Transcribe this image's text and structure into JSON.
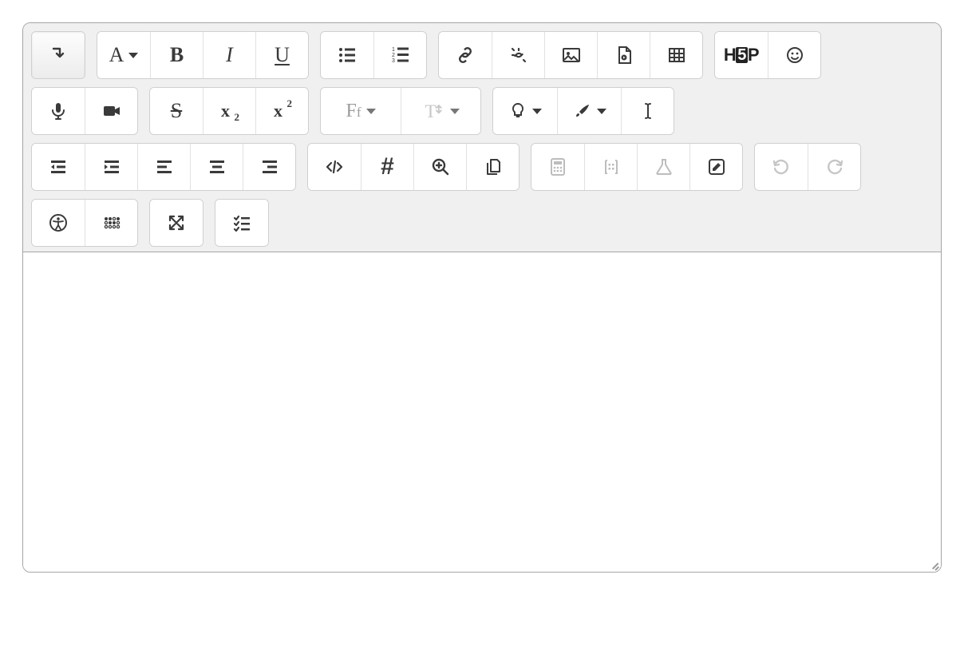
{
  "toolbar": {
    "collapse": {
      "name": "toggle-toolbar-button",
      "active": true
    },
    "paragraph_style": {
      "name": "paragraph-style-dropdown",
      "label": "A"
    },
    "bold": {
      "label": "B"
    },
    "italic": {
      "label": "I"
    },
    "underline": {
      "label": "U"
    },
    "strike": {
      "label": "S"
    },
    "subscript_base": "x",
    "subscript_sub": "2",
    "superscript_base": "x",
    "superscript_sup": "2",
    "font_family_label_big": "F",
    "font_family_label_small": "f",
    "font_size_label": "T",
    "h5p_label_left": "H",
    "h5p_label_mid": "5",
    "h5p_label_right": "P",
    "hash_label": "#"
  },
  "content": {
    "body_html": ""
  }
}
